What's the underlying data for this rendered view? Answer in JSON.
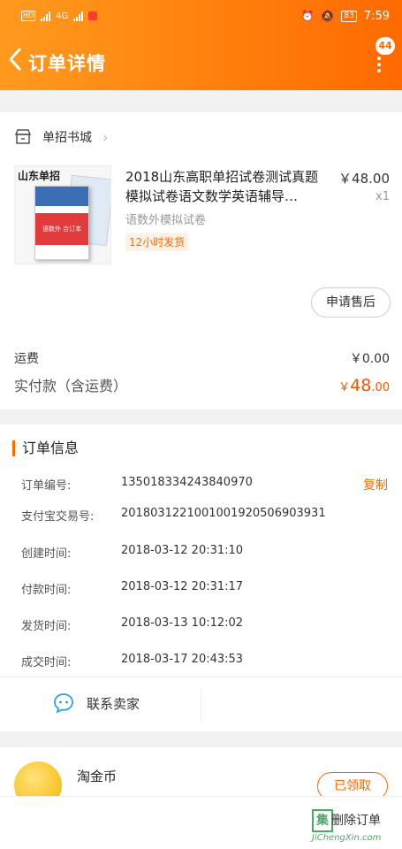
{
  "status_bar": {
    "time": "7:59",
    "battery": "83",
    "hd": "HD",
    "network": "4G"
  },
  "header": {
    "title": "订单详情",
    "message_count": "44"
  },
  "shop": {
    "name": "单招书城"
  },
  "product": {
    "name": "2018山东高职单招试卷测试真题模拟试卷语文数学英语辅导…",
    "sku": "语数外模拟试卷",
    "tag": "12小时发货",
    "price": "￥48.00",
    "qty": "x1",
    "thumb_brand": "山东单招",
    "thumb_book_text": "语数外 合订本"
  },
  "aftersale_button": "申请售后",
  "shipping": {
    "label": "运费",
    "value": "￥0.00"
  },
  "total": {
    "label": "实付款（含运费）",
    "currency": "￥",
    "integer": "48",
    "decimal": ".00"
  },
  "order_info": {
    "title": "订单信息",
    "copy_label": "复制",
    "rows": [
      {
        "label": "订单编号:",
        "value": "135018334243840970"
      },
      {
        "label": "支付宝交易号:",
        "value": "2018031221001001920506903931"
      },
      {
        "label": "创建时间:",
        "value": "2018-03-12 20:31:10"
      },
      {
        "label": "付款时间:",
        "value": "2018-03-12 20:31:17"
      },
      {
        "label": "发货时间:",
        "value": "2018-03-13 10:12:02"
      },
      {
        "label": "成交时间:",
        "value": "2018-03-17 20:43:53"
      }
    ],
    "contact_seller": "联系卖家"
  },
  "coin": {
    "title": "淘金币",
    "button": "已领取"
  },
  "bottom": {
    "delete_order": "删除订单"
  },
  "watermark": {
    "text": "JiChengXin.com",
    "logo_char": "集"
  },
  "colors": {
    "accent": "#ff6a00",
    "price": "#ff5000"
  }
}
